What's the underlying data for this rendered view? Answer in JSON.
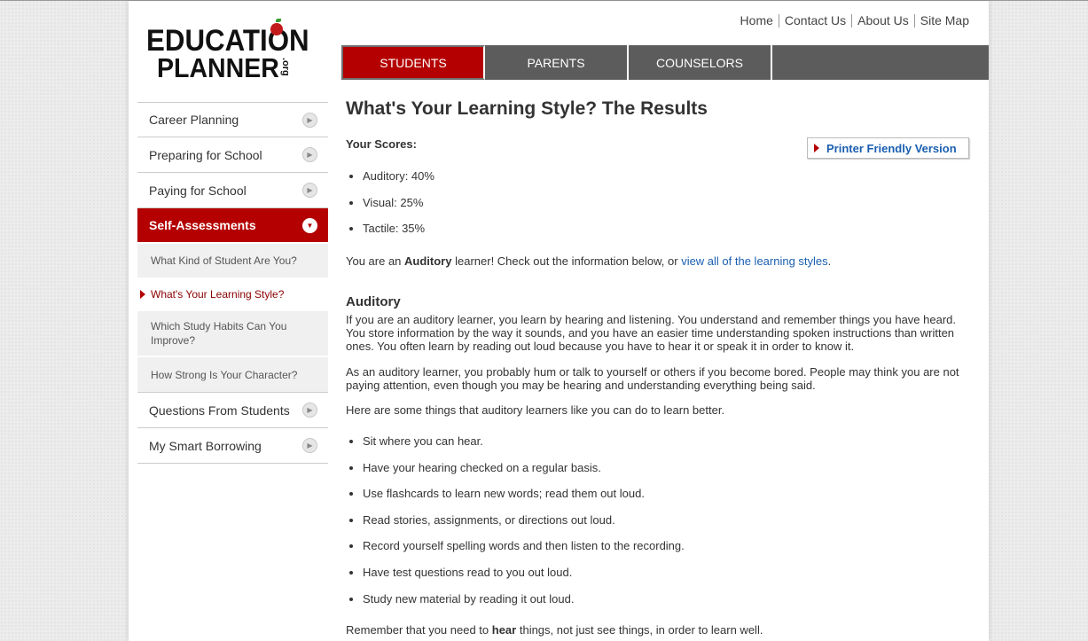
{
  "logo": {
    "line1": "EDUCATION",
    "line2": "PLANNER",
    "suffix": ".org",
    "apple_color": "#c4191a"
  },
  "utility_links": [
    "Home",
    "Contact Us",
    "About Us",
    "Site Map"
  ],
  "main_nav": [
    {
      "label": "STUDENTS",
      "active": true
    },
    {
      "label": "PARENTS",
      "active": false
    },
    {
      "label": "COUNSELORS",
      "active": false
    }
  ],
  "sidebar": {
    "top_items": [
      "Career Planning",
      "Preparing for School",
      "Paying for School"
    ],
    "active_section": "Self-Assessments",
    "sub_items": [
      "What Kind of Student Are You?",
      "What's Your Learning Style?",
      "Which Study Habits Can You Improve?",
      "How Strong Is Your Character?"
    ],
    "bottom_items": [
      "Questions From Students",
      "My Smart Borrowing"
    ]
  },
  "content": {
    "title": "What's Your Learning Style? The Results",
    "printer_link": "Printer Friendly Version",
    "scores_label": "Your Scores:",
    "scores": [
      "Auditory: 40%",
      "Visual: 25%",
      "Tactile: 35%"
    ],
    "result_prefix": "You are an ",
    "result_style": "Auditory",
    "result_mid": " learner! Check out the information below, or ",
    "result_link": "view all of the learning styles",
    "result_end": ".",
    "section_heading": "Auditory",
    "para1": "If you are an auditory learner, you learn by hearing and listening. You understand and remember things you have heard. You store information by the way it sounds, and you have an easier time understanding spoken instructions than written ones. You often learn by reading out loud because you have to hear it or speak it in order to know it.",
    "para2": "As an auditory learner, you probably hum or talk to yourself or others if you become bored. People may think you are not paying attention, even though you may be hearing and understanding everything being said.",
    "para3": "Here are some things that auditory learners like you can do to learn better.",
    "tips": [
      "Sit where you can hear.",
      "Have your hearing checked on a regular basis.",
      "Use flashcards to learn new words; read them out loud.",
      "Read stories, assignments, or directions out loud.",
      "Record yourself spelling words and then listen to the recording.",
      "Have test questions read to you out loud.",
      "Study new material by reading it out loud."
    ],
    "closing_prefix": "Remember that you need to ",
    "closing_bold": "hear",
    "closing_suffix": " things, not just see things, in order to learn well."
  },
  "colors": {
    "brand_red": "#b40000",
    "nav_gray": "#5c5c5c",
    "link_blue": "#1a5fb0"
  }
}
